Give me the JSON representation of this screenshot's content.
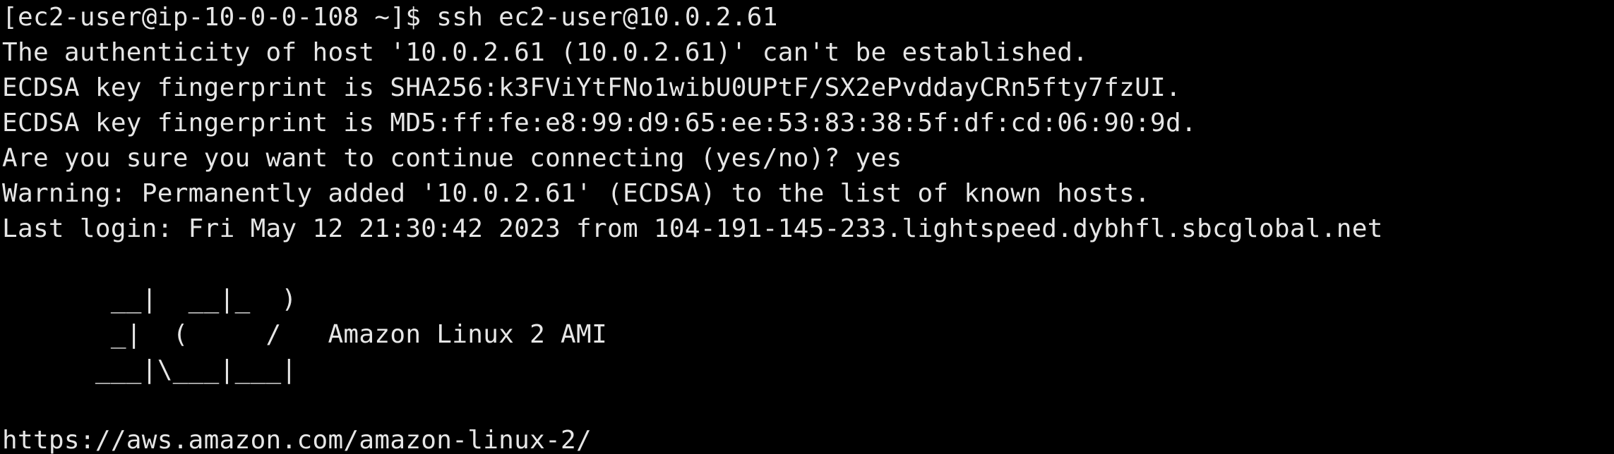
{
  "terminal": {
    "prompt": "[ec2-user@ip-10-0-0-108 ~]$ ",
    "command": "ssh ec2-user@10.0.2.61",
    "output": [
      "The authenticity of host '10.0.2.61 (10.0.2.61)' can't be established.",
      "ECDSA key fingerprint is SHA256:k3FViYtFNo1wibU0UPtF/SX2ePvddayCRn5fty7fzUI.",
      "ECDSA key fingerprint is MD5:ff:fe:e8:99:d9:65:ee:53:83:38:5f:df:cd:06:90:9d.",
      "Are you sure you want to continue connecting (yes/no)? yes",
      "Warning: Permanently added '10.0.2.61' (ECDSA) to the list of known hosts.",
      "Last login: Fri May 12 21:30:42 2023 from 104-191-145-233.lightspeed.dybhfl.sbcglobal.net"
    ],
    "banner": [
      "       __|  __|_  )",
      "       _|  (     /   Amazon Linux 2 AMI",
      "      ___|\\___|___|"
    ],
    "url": "https://aws.amazon.com/amazon-linux-2/"
  },
  "colors": {
    "background": "#000000",
    "foreground": "#e6e6e6"
  }
}
